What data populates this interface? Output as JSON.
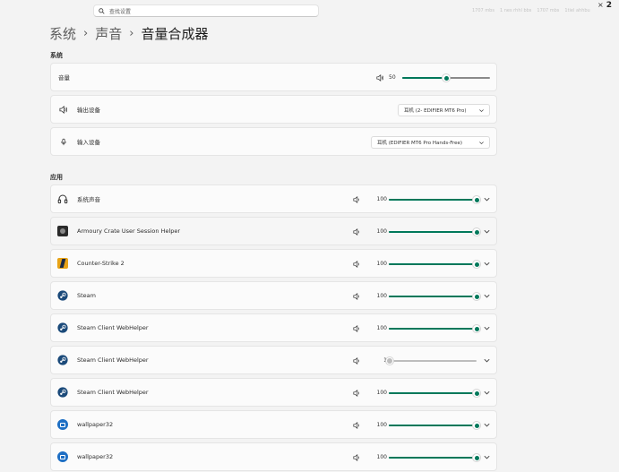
{
  "search": {
    "placeholder": "查找设置"
  },
  "taskbar_tray": [
    "1707 mbs",
    "1 nes rhhl bbs",
    "1707 mbs",
    "1tiel ahhbu"
  ],
  "window_corner": {
    "close_glyph": "×",
    "badge": "2"
  },
  "breadcrumb": {
    "level1": "系统",
    "level2": "声音",
    "current": "音量合成器"
  },
  "system_section": {
    "label": "系统",
    "volume": {
      "label": "音量",
      "value": "50",
      "level": 0.5
    },
    "output_device": {
      "label": "输出设备",
      "selected": "耳机 (2- EDIFIER MT6 Pro)"
    },
    "input_device": {
      "label": "输入设备",
      "selected": "耳机 (EDIFIER MT6 Pro Hands-Free)"
    }
  },
  "apps_section": {
    "label": "应用",
    "apps": [
      {
        "name": "系统声音",
        "icon": "headphones-icon",
        "volume": "100",
        "level": 1.0
      },
      {
        "name": "Armoury Crate User Session Helper",
        "icon": "armoury-crate-icon",
        "volume": "100",
        "level": 1.0
      },
      {
        "name": "Counter-Strike 2",
        "icon": "counter-strike-icon",
        "volume": "100",
        "level": 1.0
      },
      {
        "name": "Steam",
        "icon": "steam-icon",
        "volume": "100",
        "level": 1.0
      },
      {
        "name": "Steam Client WebHelper",
        "icon": "steam-icon",
        "volume": "100",
        "level": 1.0
      },
      {
        "name": "Steam Client WebHelper",
        "icon": "steam-icon",
        "volume": "1",
        "level": 0.01
      },
      {
        "name": "Steam Client WebHelper",
        "icon": "steam-icon",
        "volume": "100",
        "level": 1.0
      },
      {
        "name": "wallpaper32",
        "icon": "wallpaper-engine-icon",
        "volume": "100",
        "level": 1.0
      },
      {
        "name": "wallpaper32",
        "icon": "wallpaper-engine-icon",
        "volume": "100",
        "level": 1.0
      }
    ]
  },
  "colors": {
    "accent": "#00785a",
    "background": "#f3f3f3",
    "card": "#fbfbfb",
    "muted_thumb": "#bdbdbd"
  }
}
